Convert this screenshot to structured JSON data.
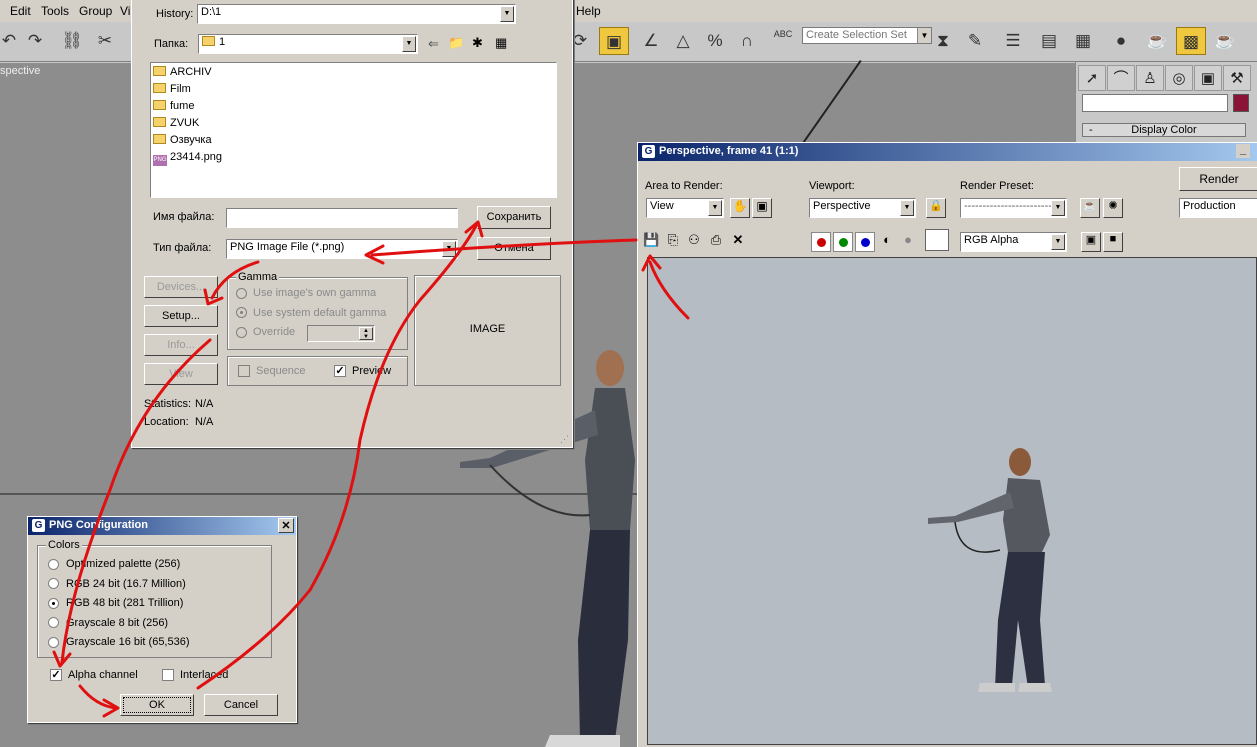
{
  "menu": {
    "edit": "Edit",
    "tools": "Tools",
    "group": "Group",
    "views_partial": "Vi",
    "help": "Help"
  },
  "toolbar": {
    "selection_set_placeholder": "Create Selection Set",
    "abc_label": "ABC"
  },
  "viewport": {
    "label": "spective"
  },
  "command_panel": {
    "rollout_minus": "-",
    "rollout_label": "Display Color",
    "object_color": "#8a1438"
  },
  "file_dialog": {
    "history_label": "History:",
    "history_value": "D:\\1",
    "folder_label": "Папка:",
    "folder_value": "1",
    "files": [
      {
        "name": "ARCHIV",
        "icon": "folder-icon"
      },
      {
        "name": "Film",
        "icon": "folder-icon"
      },
      {
        "name": "fume",
        "icon": "folder-icon"
      },
      {
        "name": "ZVUK",
        "icon": "folder-icon"
      },
      {
        "name": "Озвучка",
        "icon": "folder-icon"
      },
      {
        "name": "23414.png",
        "icon": "png-file-icon",
        "icon_text": "PNG"
      }
    ],
    "filename_label": "Имя файла:",
    "filename_value": "",
    "filetype_label": "Тип файла:",
    "filetype_value": "PNG Image File (*.png)",
    "save_button": "Сохранить",
    "cancel_button": "Отмена",
    "devices_button": "Devices...",
    "setup_button": "Setup...",
    "info_button": "Info...",
    "view_button": "View",
    "gamma_title": "Gamma",
    "gamma_own": "Use image's own gamma",
    "gamma_system": "Use system default gamma",
    "gamma_override": "Override",
    "sequence_label": "Sequence",
    "preview_label": "Preview",
    "image_label": "IMAGE",
    "statistics_label": "Statistics:",
    "statistics_value": "N/A",
    "location_label": "Location:",
    "location_value": "N/A"
  },
  "png_config": {
    "title": "PNG Configuration",
    "colors_title": "Colors",
    "options": [
      "Optimized palette  (256)",
      "RGB 24 bit  (16.7 Million)",
      "RGB 48 bit  (281 Trillion)",
      "Grayscale 8 bit  (256)",
      "Grayscale 16 bit  (65,536)"
    ],
    "selected_index": 2,
    "alpha_label": "Alpha channel",
    "alpha_checked": true,
    "interlaced_label": "Interlaced",
    "interlaced_checked": false,
    "ok_button": "OK",
    "cancel_button": "Cancel"
  },
  "render_frame": {
    "title": "Perspective, frame 41 (1:1)",
    "area_label": "Area to Render:",
    "area_value": "View",
    "viewport_label": "Viewport:",
    "viewport_value": "Perspective",
    "preset_label": "Render Preset:",
    "preset_value": "-------------------------",
    "render_button": "Render",
    "production_value": "Production",
    "channel_value": "RGB Alpha",
    "channel_colors": {
      "red": "#cc0000",
      "green": "#008800",
      "blue": "#0000cc"
    },
    "background_color": "#b6bcc4"
  },
  "annotation_color": "#e01010"
}
